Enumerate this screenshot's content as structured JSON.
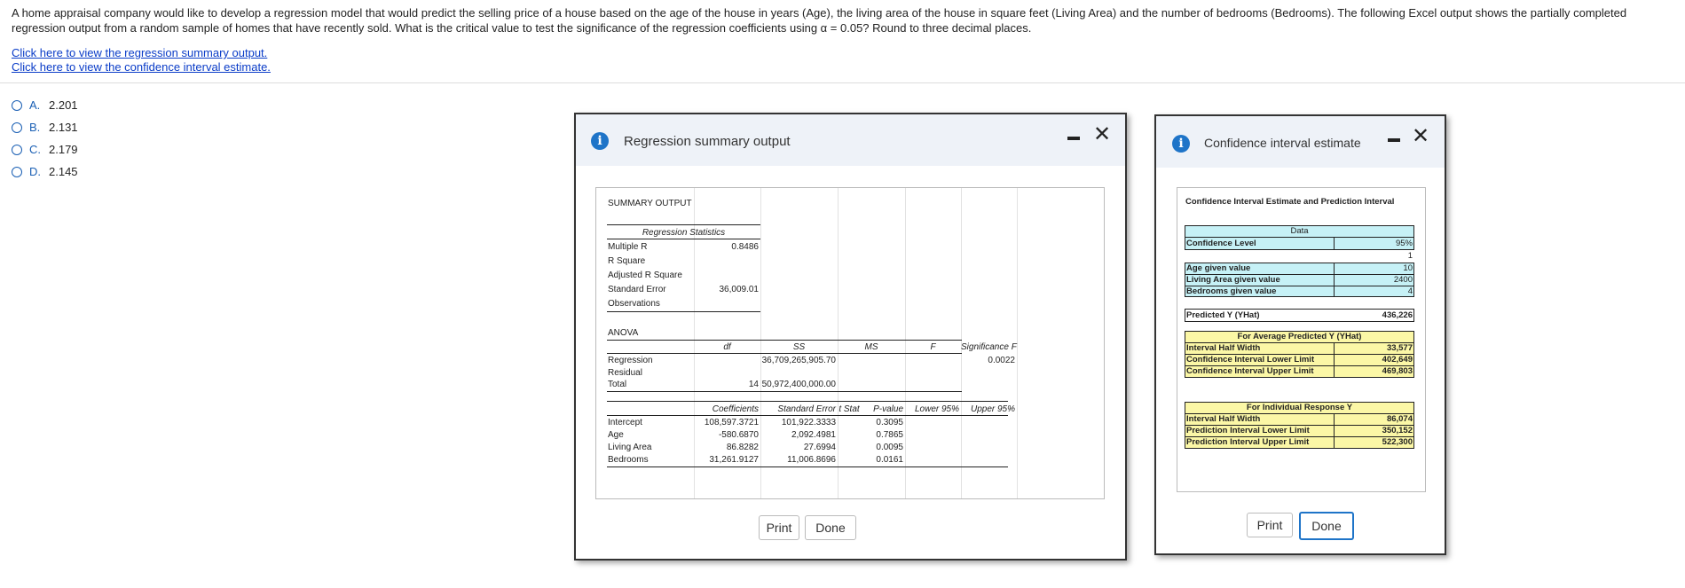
{
  "question": {
    "text": "A home appraisal company would like to develop a regression model that would predict the selling price of a house based on the age of the house in years (Age), the living area of the house in square feet (Living Area) and the number of bedrooms (Bedrooms). The following Excel output shows the partially completed regression output from a random sample of homes that have recently sold. What is the critical value to test the significance of the regression coefficients using α = 0.05? Round to three decimal places.",
    "link_summary": "Click here to view the regression summary output.",
    "link_ci": "Click here to view the confidence interval estimate."
  },
  "options": [
    {
      "letter": "A.",
      "value": "2.201"
    },
    {
      "letter": "B.",
      "value": "2.131"
    },
    {
      "letter": "C.",
      "value": "2.179"
    },
    {
      "letter": "D.",
      "value": "2.145"
    }
  ],
  "summary_dialog": {
    "title": "Regression summary output",
    "print": "Print",
    "done": "Done",
    "sheet": {
      "heading": "SUMMARY OUTPUT",
      "reg_stats_title": "Regression Statistics",
      "reg_stats": [
        {
          "label": "Multiple R",
          "value": "0.8486"
        },
        {
          "label": "R Square",
          "value": ""
        },
        {
          "label": "Adjusted R Square",
          "value": ""
        },
        {
          "label": "Standard Error",
          "value": "36,009.01"
        },
        {
          "label": "Observations",
          "value": ""
        }
      ],
      "anova_title": "ANOVA",
      "anova_headers": [
        "df",
        "SS",
        "MS",
        "F",
        "Significance F"
      ],
      "anova_rows": [
        {
          "label": "Regression",
          "df": "",
          "ss": "36,709,265,905.70",
          "ms": "",
          "f": "",
          "sigf": "0.0022"
        },
        {
          "label": "Residual",
          "df": "",
          "ss": "",
          "ms": "",
          "f": "",
          "sigf": ""
        },
        {
          "label": "Total",
          "df": "14",
          "ss": "50,972,400,000.00",
          "ms": "",
          "f": "",
          "sigf": ""
        }
      ],
      "coef_headers": [
        "Coefficients",
        "Standard Error",
        "t Stat",
        "P-value",
        "Lower 95%",
        "Upper 95%"
      ],
      "coef_rows": [
        {
          "label": "Intercept",
          "coef": "108,597.3721",
          "se": "101,922.3333",
          "pval": "0.3095"
        },
        {
          "label": "Age",
          "coef": "-580.6870",
          "se": "2,092.4981",
          "pval": "0.7865"
        },
        {
          "label": "Living Area",
          "coef": "86.8282",
          "se": "27.6994",
          "pval": "0.0095"
        },
        {
          "label": "Bedrooms",
          "coef": "31,261.9127",
          "se": "11,006.8696",
          "pval": "0.0161"
        }
      ]
    }
  },
  "ci_dialog": {
    "title": "Confidence interval estimate",
    "print": "Print",
    "done": "Done",
    "sheet": {
      "heading": "Confidence Interval Estimate and Prediction Interval",
      "data_title": "Data",
      "confidence_label": "Confidence Level",
      "confidence_value": "95%",
      "one": "1",
      "givens": [
        {
          "label": "Age given value",
          "value": "10"
        },
        {
          "label": "Living Area given value",
          "value": "2400"
        },
        {
          "label": "Bedrooms given value",
          "value": "4"
        }
      ],
      "yhat_label": "Predicted Y (YHat)",
      "yhat_value": "436,226",
      "avg_title": "For Average Predicted Y (YHat)",
      "avg_rows": [
        {
          "label": "Interval Half Width",
          "value": "33,577"
        },
        {
          "label": "Confidence Interval Lower Limit",
          "value": "402,649"
        },
        {
          "label": "Confidence Interval Upper Limit",
          "value": "469,803"
        }
      ],
      "ind_title": "For Individual Response Y",
      "ind_rows": [
        {
          "label": "Interval Half Width",
          "value": "86,074"
        },
        {
          "label": "Prediction Interval Lower Limit",
          "value": "350,152"
        },
        {
          "label": "Prediction Interval Upper Limit",
          "value": "522,300"
        }
      ]
    }
  },
  "colors": {
    "link": "#0a3cc8",
    "accent": "#1e74c8",
    "cyan": "#c6f1f6",
    "yellow": "#fbf7a6"
  }
}
